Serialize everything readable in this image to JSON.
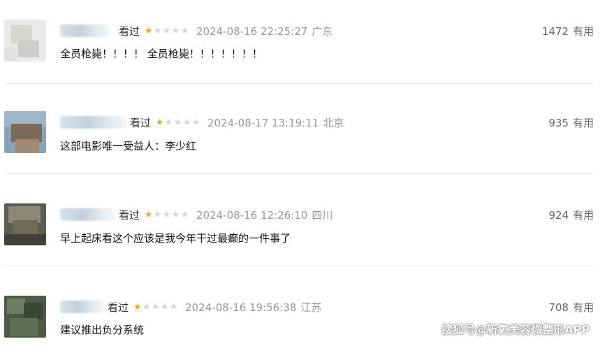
{
  "comments": [
    {
      "watched_label": "看过",
      "rating": 1,
      "time": "2024-08-16 22:25:27",
      "location": "广东",
      "votes": "1472",
      "useful_label": "有用",
      "content": "全员枪毙！！！！ 全员枪毙！！！！！！！"
    },
    {
      "watched_label": "看过",
      "rating": 1,
      "time": "2024-08-17 13:19:11",
      "location": "北京",
      "votes": "935",
      "useful_label": "有用",
      "content": "这部电影唯一受益人：李少红"
    },
    {
      "watched_label": "看过",
      "rating": 1,
      "time": "2024-08-16 12:26:10",
      "location": "四川",
      "votes": "924",
      "useful_label": "有用",
      "content": "早上起床看这个应该是我今年干过最癫的一件事了"
    },
    {
      "watched_label": "看过",
      "rating": 1,
      "time": "2024-08-16 19:56:38",
      "location": "江苏",
      "votes": "708",
      "useful_label": "有用",
      "content": "建议推出负分系统"
    }
  ],
  "rating_max": 5,
  "colors": {
    "star_on": "#f5a623",
    "star_off": "#d6d6d6",
    "meta_gray": "#999999"
  },
  "watermark": "搜狐号@新氧美容微整形APP"
}
